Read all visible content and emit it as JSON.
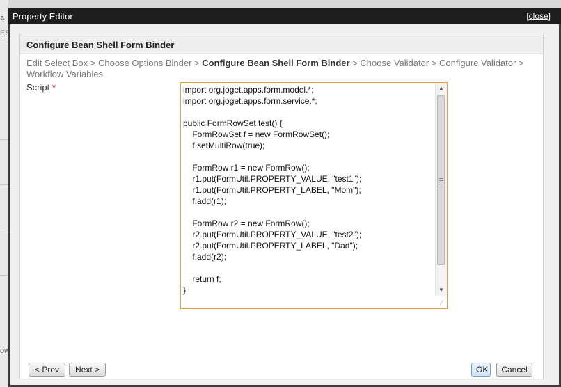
{
  "window": {
    "title": "Property Editor",
    "close_label": "[close]"
  },
  "panel": {
    "title": "Configure Bean Shell Form Binder"
  },
  "breadcrumb": {
    "steps": [
      "Edit Select Box",
      "Choose Options Binder",
      "Configure Bean Shell Form Binder",
      "Choose Validator",
      "Configure Validator",
      "Workflow Variables"
    ],
    "current_index": 2,
    "separator": " > "
  },
  "field": {
    "label": "Script",
    "required_mark": "*",
    "value": "import org.joget.apps.form.model.*;\nimport org.joget.apps.form.service.*;\n\npublic FormRowSet test() {\n\tFormRowSet f = new FormRowSet();\n\tf.setMultiRow(true);\n\n\tFormRow r1 = new FormRow();\n\tr1.put(FormUtil.PROPERTY_VALUE, \"test1\");\n\tr1.put(FormUtil.PROPERTY_LABEL, \"Mom\");\n\tf.add(r1);\n\n\tFormRow r2 = new FormRow();\n\tr2.put(FormUtil.PROPERTY_VALUE, \"test2\");\n\tr2.put(FormUtil.PROPERTY_LABEL, \"Dad\");\n\tf.add(r2);\n\n\treturn f;\n}"
  },
  "buttons": {
    "prev": "< Prev",
    "next": "Next >",
    "ok": "OK",
    "cancel": "Cancel"
  },
  "background": {
    "fragment_1": "a",
    "fragment_2": "ES",
    "fragment_3": "ow"
  },
  "colors": {
    "titlebar": "#1e1e1e",
    "field_focus_border": "#e1a23a",
    "required": "#dd0000"
  }
}
